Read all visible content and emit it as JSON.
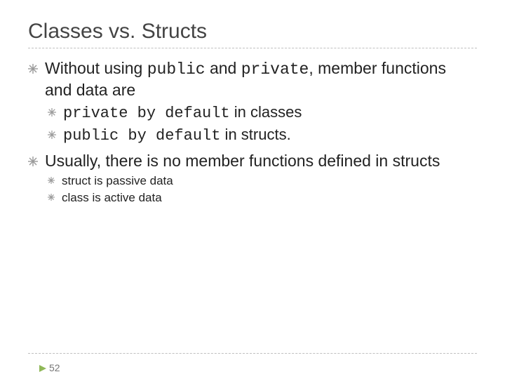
{
  "title": "Classes vs. Structs",
  "b1": {
    "pre": "Without using ",
    "kw1": "public",
    "mid1": " and ",
    "kw2": "private",
    "post": ", member functions and data are"
  },
  "b1a": {
    "kw": "private by default",
    "post": " in classes"
  },
  "b1b": {
    "kw": "public by default",
    "post": " in structs."
  },
  "b2": "Usually, there is no member functions defined in structs",
  "b2a": "struct  is passive data",
  "b2b": "class is active data",
  "page": "52"
}
